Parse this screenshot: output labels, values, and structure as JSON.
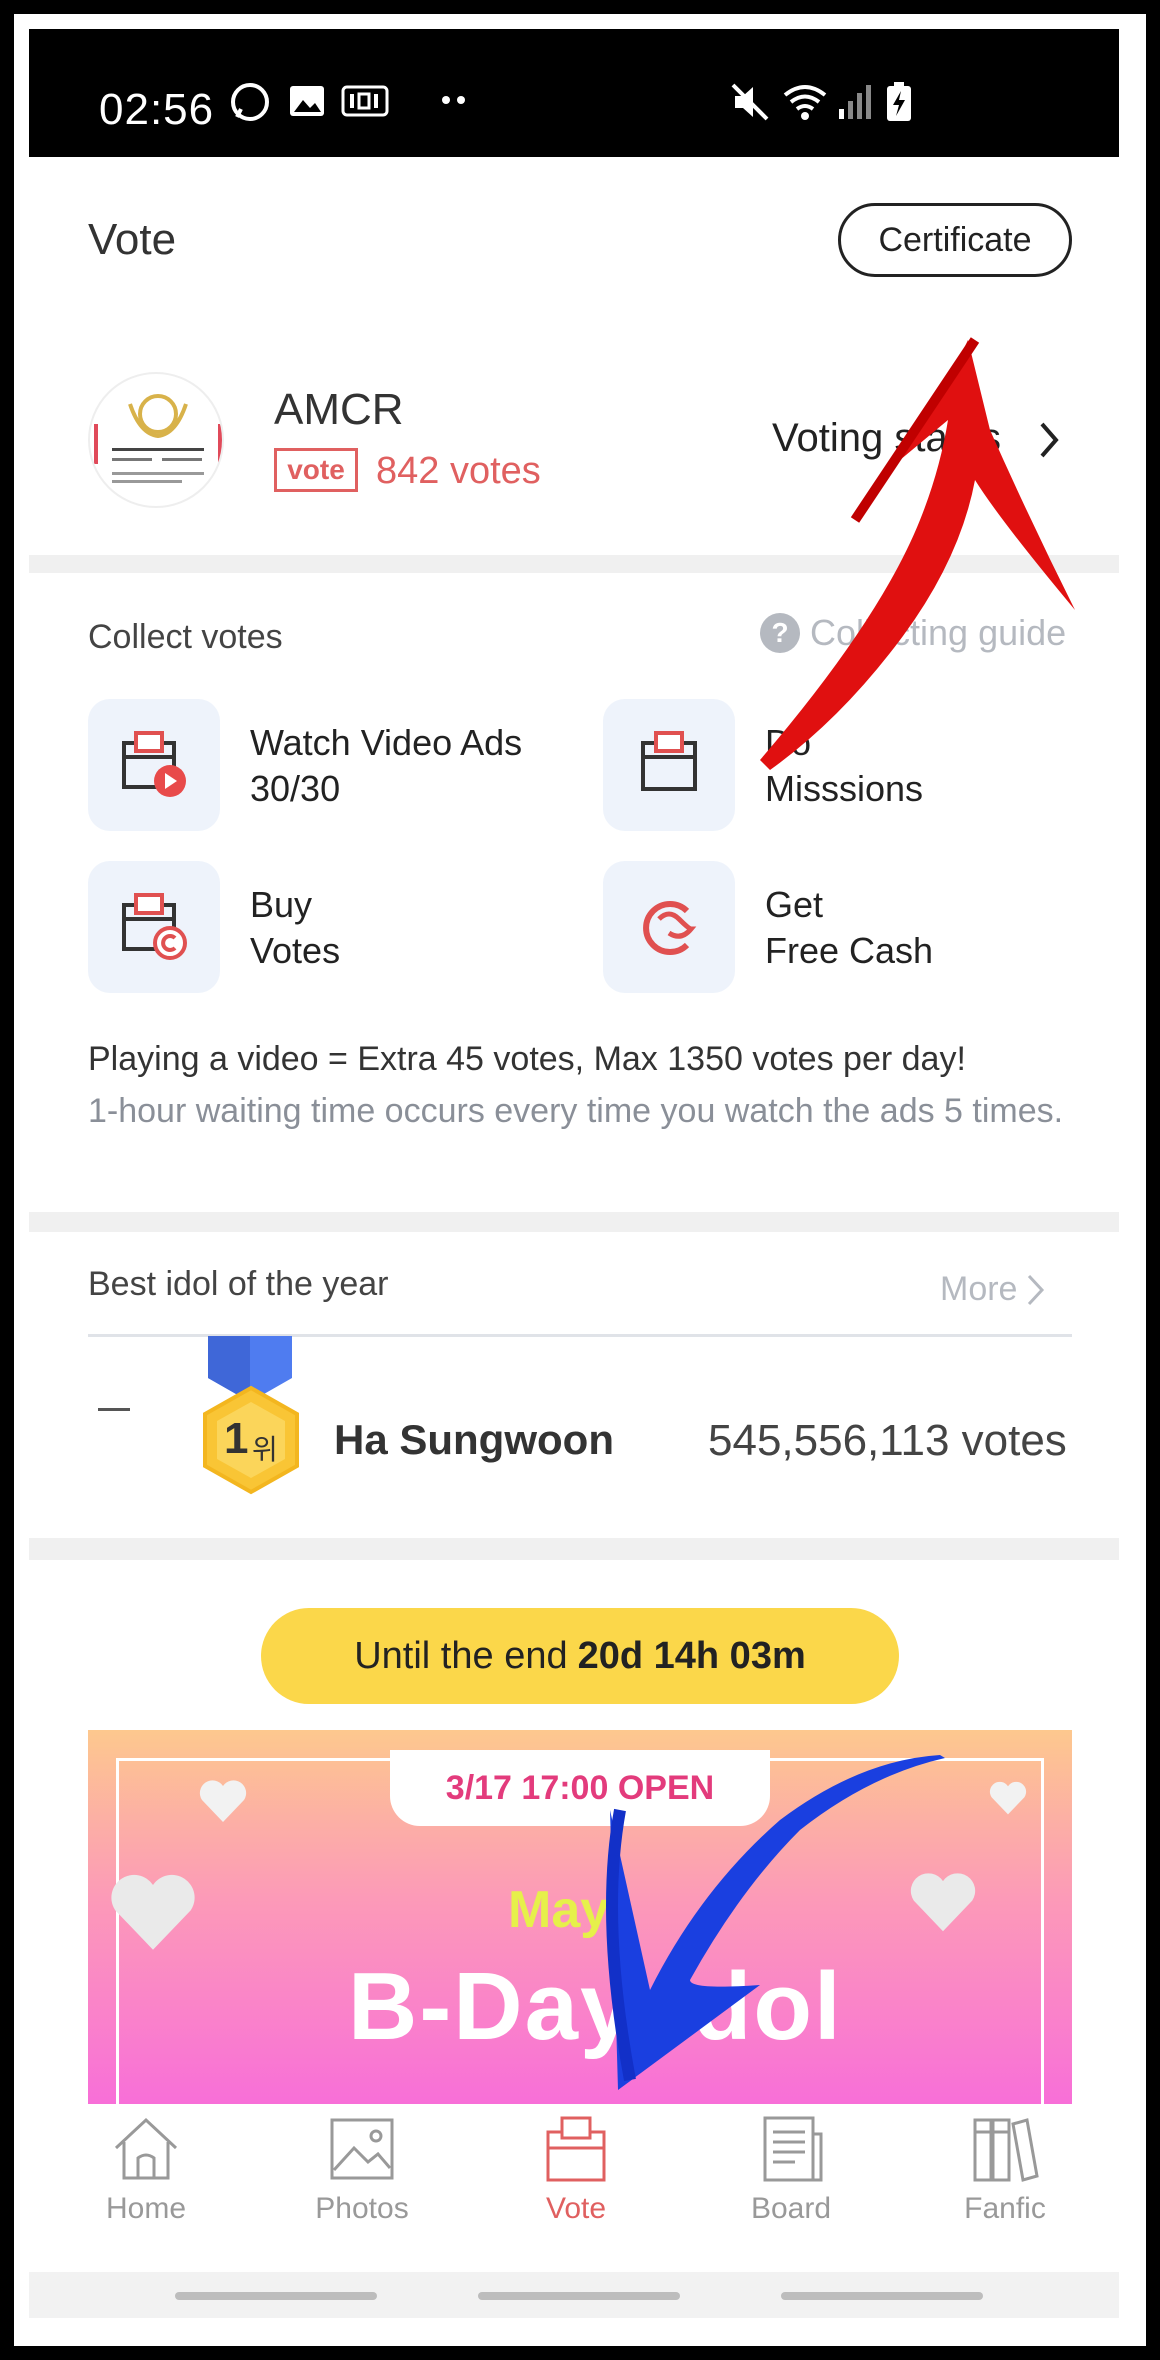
{
  "status_bar": {
    "time": "02:56"
  },
  "header": {
    "title": "Vote",
    "certificate_label": "Certificate"
  },
  "profile": {
    "name": "AMCR",
    "badge": "vote",
    "votes": "842 votes",
    "voting_status_label": "Voting status"
  },
  "collect": {
    "title": "Collect votes",
    "guide_label": "Collecting guide",
    "items": [
      {
        "label": "Watch Video Ads\n30/30",
        "icon": "video-ad-icon"
      },
      {
        "label": "Do\n Misssions",
        "icon": "missions-icon"
      },
      {
        "label": "Buy\nVotes",
        "icon": "buy-votes-icon"
      },
      {
        "label": "Get\nFree Cash",
        "icon": "free-cash-icon"
      }
    ],
    "info_line1": "Playing a video = Extra 45 votes, Max 1350 votes per day!",
    "info_line2": "1-hour waiting time occurs every time you watch the ads 5 times."
  },
  "best_idol": {
    "title": "Best idol of the year",
    "more_label": "More",
    "rank_change": "—",
    "rank_number": "1",
    "rank_suffix": "위",
    "name": "Ha Sungwoon",
    "votes": "545,556,113 votes"
  },
  "countdown": {
    "prefix": "Until the end",
    "remaining": "20d 14h 03m"
  },
  "banner": {
    "open_text": "3/17 17:00 OPEN",
    "month": "May.",
    "title": "B-Day Idol"
  },
  "bottom_nav": {
    "items": [
      {
        "label": "Home",
        "icon": "home-icon"
      },
      {
        "label": "Photos",
        "icon": "photos-icon"
      },
      {
        "label": "Vote",
        "icon": "vote-icon",
        "active": true
      },
      {
        "label": "Board",
        "icon": "board-icon"
      },
      {
        "label": "Fanfic",
        "icon": "fanfic-icon"
      }
    ]
  },
  "colors": {
    "accent": "#e06060",
    "countdown_bg": "#fbd74a",
    "tile_bg": "#eef3fb",
    "medal": "#f9c535",
    "ribbon": "#4f7cf0"
  }
}
